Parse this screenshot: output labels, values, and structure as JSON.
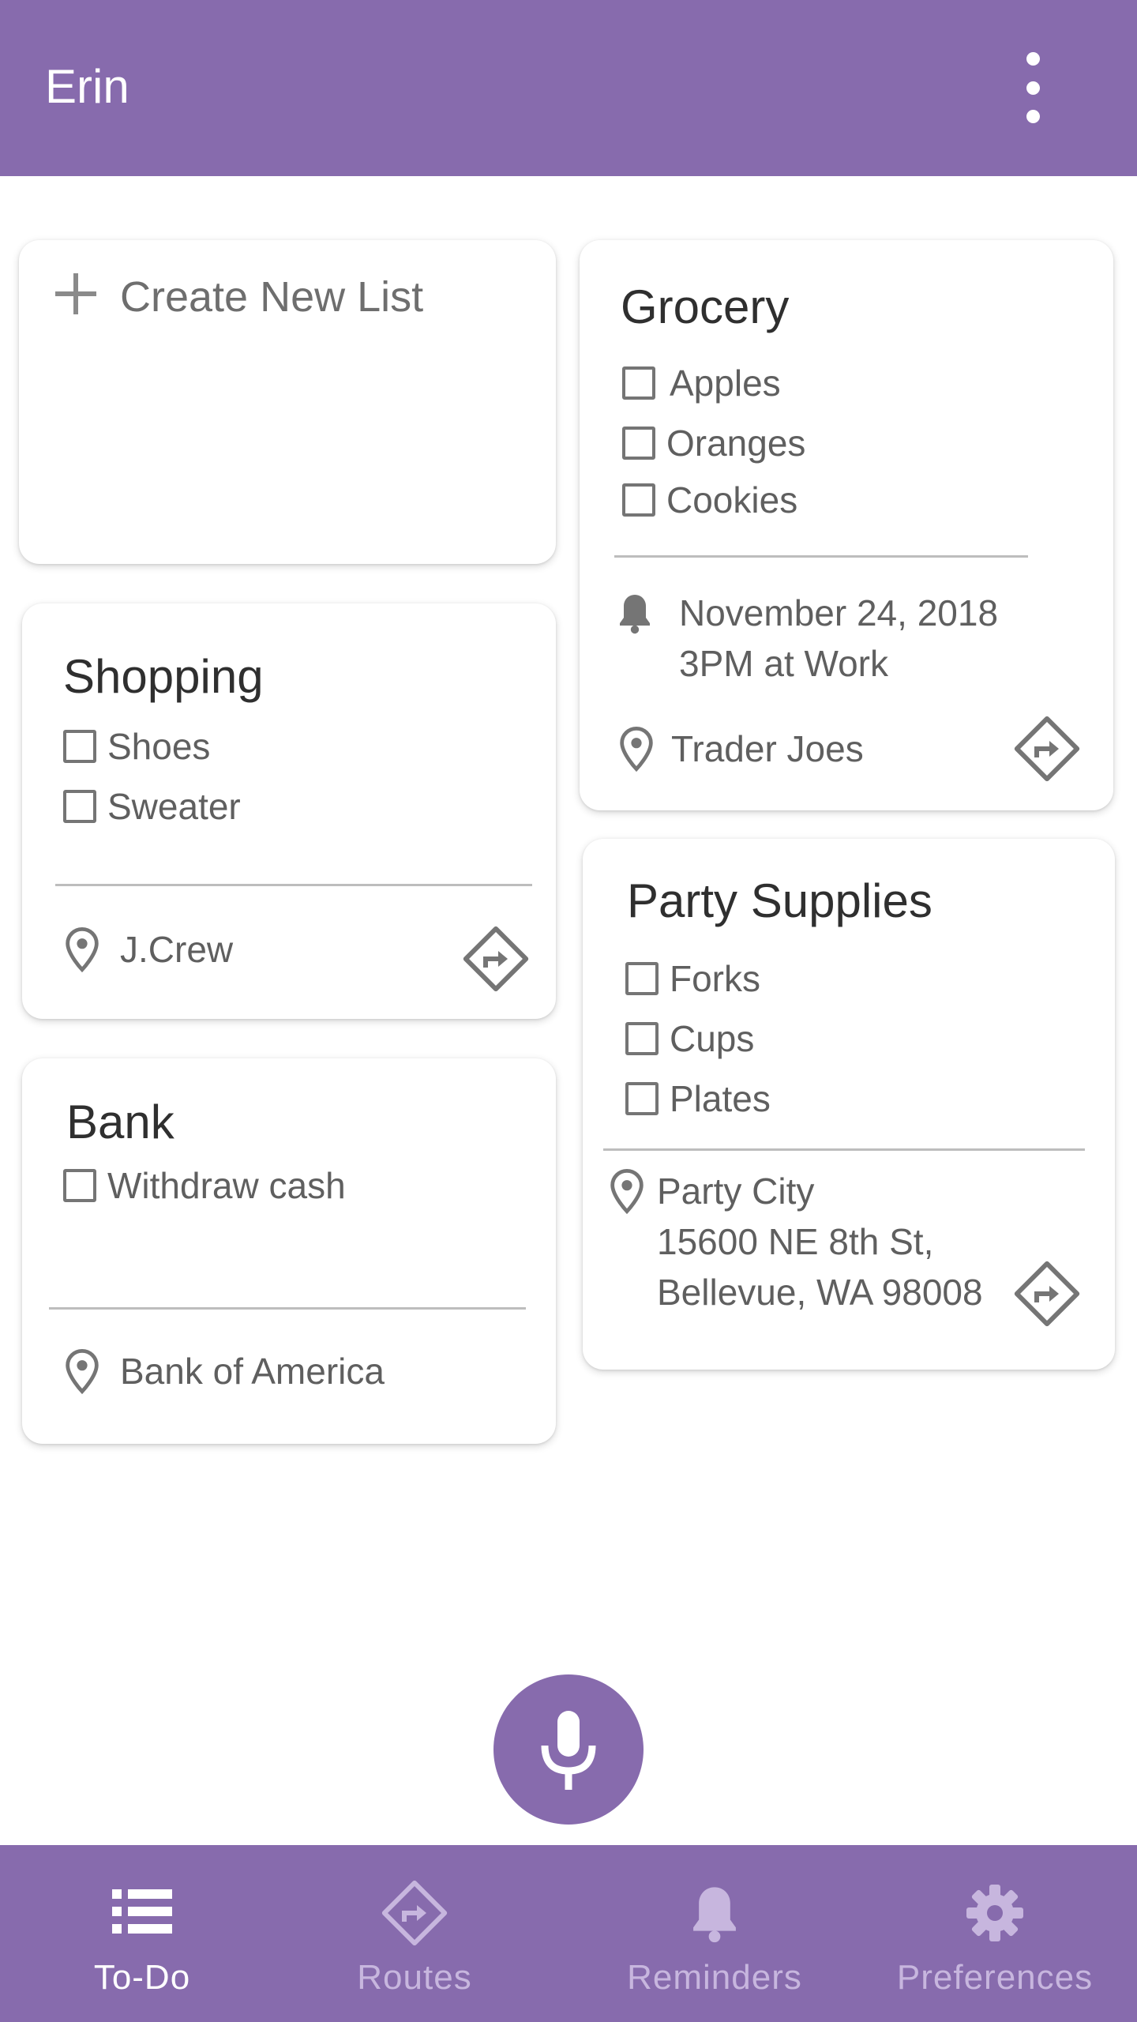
{
  "appbar": {
    "title": "Erin"
  },
  "create_card": {
    "label": "Create New List"
  },
  "lists": {
    "shopping": {
      "title": "Shopping",
      "items": [
        "Shoes",
        "Sweater"
      ],
      "location": "J.Crew"
    },
    "bank": {
      "title": "Bank",
      "items": [
        "Withdraw cash"
      ],
      "location": "Bank of America"
    },
    "grocery": {
      "title": "Grocery",
      "items": [
        "Apples",
        "Oranges",
        "Cookies"
      ],
      "reminder_date": "November 24, 2018",
      "reminder_detail": "3PM at Work",
      "location": "Trader Joes"
    },
    "party": {
      "title": "Party Supplies",
      "items": [
        "Forks",
        "Cups",
        "Plates"
      ],
      "location_name": "Party City",
      "address_line1": "15600 NE 8th St,",
      "address_line2": "Bellevue, WA 98008"
    }
  },
  "bottom_nav": {
    "items": [
      {
        "label": "To-Do",
        "icon": "list-icon",
        "active": true
      },
      {
        "label": "Routes",
        "icon": "directions-icon",
        "active": false
      },
      {
        "label": "Reminders",
        "icon": "bell-icon",
        "active": false
      },
      {
        "label": "Preferences",
        "icon": "gear-icon",
        "active": false
      }
    ]
  },
  "colors": {
    "primary": "#876bad",
    "nav_inactive": "#c7b6de",
    "text": "#5f5f5f",
    "icon_gray": "#757575"
  }
}
